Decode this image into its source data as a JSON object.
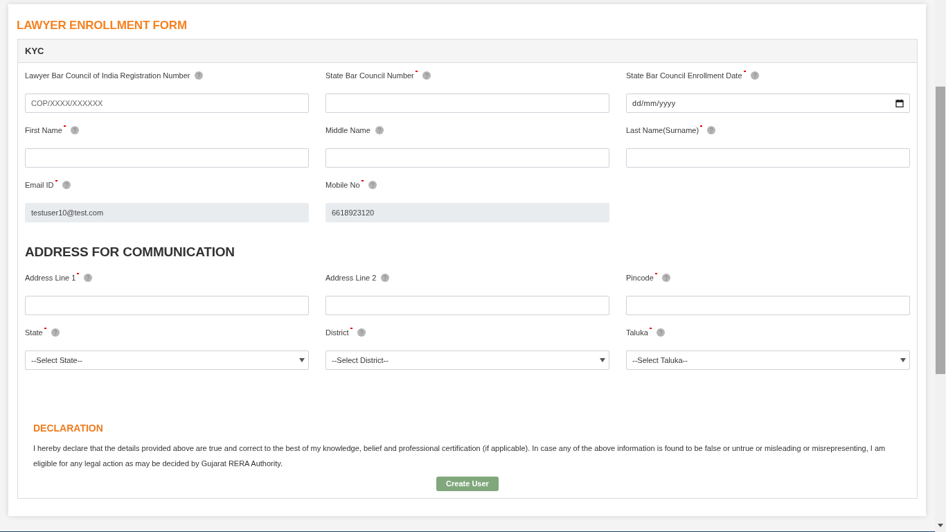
{
  "title": "LAWYER ENROLLMENT FORM",
  "kyc": {
    "header": "KYC",
    "fields": [
      {
        "kind": "text",
        "label": "Lawyer Bar Council of India Registration Number",
        "required": false,
        "disabled": false,
        "placeholder": "COP/XXXX/XXXXXX"
      },
      {
        "kind": "text",
        "label": "State Bar Council Number",
        "required": true,
        "disabled": false
      },
      {
        "kind": "date",
        "label": "State Bar Council Enrollment Date",
        "required": true,
        "disabled": false,
        "placeholder": "dd/mm/yyyy"
      },
      {
        "kind": "text",
        "label": "First Name",
        "required": true,
        "disabled": false
      },
      {
        "kind": "text",
        "label": "Middle Name",
        "required": false,
        "disabled": false
      },
      {
        "kind": "text",
        "label": "Last Name(Surname)",
        "required": true,
        "disabled": false
      },
      {
        "kind": "text",
        "label": "Email ID",
        "required": true,
        "disabled": true,
        "value": "testuser10@test.com"
      },
      {
        "kind": "text",
        "label": "Mobile No",
        "required": true,
        "disabled": true,
        "value": "6618923120"
      }
    ]
  },
  "address": {
    "heading": "ADDRESS FOR COMMUNICATION",
    "fields": [
      {
        "kind": "text",
        "label": "Address Line 1",
        "required": true,
        "disabled": false
      },
      {
        "kind": "text",
        "label": "Address Line 2",
        "required": false,
        "disabled": false
      },
      {
        "kind": "text",
        "label": "Pincode",
        "required": true,
        "disabled": false
      },
      {
        "kind": "select",
        "label": "State",
        "required": true,
        "disabled": false,
        "value": "--Select State--"
      },
      {
        "kind": "select",
        "label": "District",
        "required": true,
        "disabled": false,
        "value": "--Select District--"
      },
      {
        "kind": "select",
        "label": "Taluka",
        "required": true,
        "disabled": false,
        "value": "--Select Taluka--"
      }
    ]
  },
  "declaration": {
    "heading": "DECLARATION",
    "text": "I hereby declare that the details provided above are true and correct to the best of my knowledge, belief and professional certification (if applicable). In case any of the above information is found to be false or untrue or misleading or misrepresenting, I am eligible for any legal action as may be decided by Gujarat RERA Authority."
  },
  "button": "Create User"
}
